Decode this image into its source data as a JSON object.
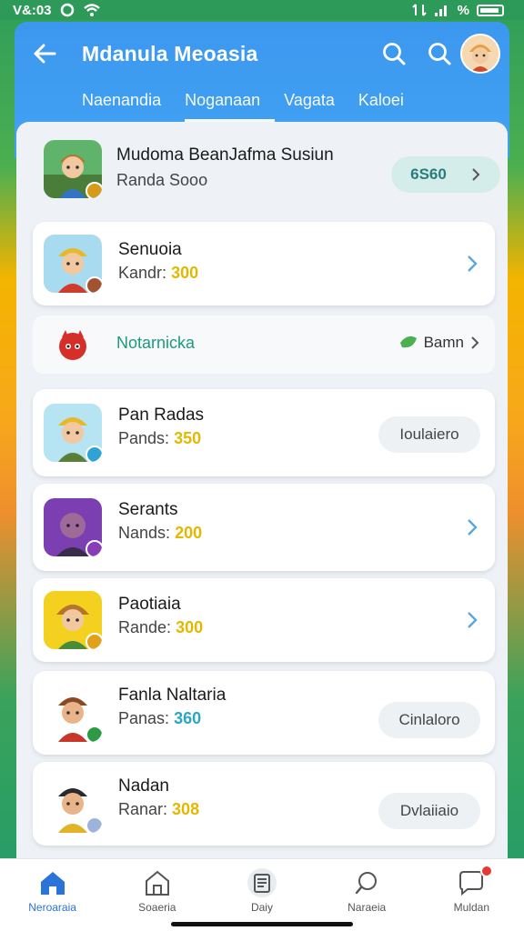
{
  "status_bar": {
    "time": "V&:03",
    "signal_text": "%"
  },
  "header": {
    "title": "Mdanula Meoasia",
    "tabs": [
      {
        "label": "Naenandia",
        "active": false
      },
      {
        "label": "Noganaan",
        "active": true
      },
      {
        "label": "Vagata",
        "active": false
      },
      {
        "label": "Kaloei",
        "active": false
      }
    ]
  },
  "list": {
    "featured": {
      "title": "Mudoma BeanJafma Susiun",
      "subtitle": "Randa Sooo",
      "pill": "6S60",
      "badge_color": "#d79b1a"
    },
    "items": [
      {
        "title": "Senuoia",
        "sub_prefix": "Kandr:",
        "sub_num": "300",
        "action": "chevron",
        "badge_color": "#a1532f"
      },
      {
        "title": "Pan Radas",
        "sub_prefix": "Pands:",
        "sub_num": "350",
        "action": "pill",
        "pill": "Ioulaiero",
        "badge_color": "#2fa3d6"
      },
      {
        "title": "Serants",
        "sub_prefix": "Nands:",
        "sub_num": "200",
        "action": "chevron",
        "badge_color": "#8a3bb8"
      },
      {
        "title": "Paotiaia",
        "sub_prefix": "Rande:",
        "sub_num": "300",
        "action": "chevron",
        "badge_color": "#e2a11a"
      },
      {
        "title": "Fanla Naltaria",
        "sub_prefix": "Panas:",
        "sub_num": "360",
        "action": "pill",
        "pill": "Cinlaloro",
        "badge_color": "#2d9a45"
      },
      {
        "title": "Nadan",
        "sub_prefix": "Ranar:",
        "sub_num": "308",
        "action": "pill",
        "pill": "Dvlaiiaio",
        "badge_color": "#9eb3d9"
      }
    ],
    "notice": {
      "title": "Notarnicka",
      "action_label": "Bamn"
    }
  },
  "bottom_nav": [
    {
      "label": "Neroaraia",
      "icon": "home-icon",
      "active": true
    },
    {
      "label": "Soaeria",
      "icon": "store-icon",
      "active": false
    },
    {
      "label": "Daiy",
      "icon": "list-icon",
      "active": false
    },
    {
      "label": "Naraeia",
      "icon": "search-icon",
      "active": false
    },
    {
      "label": "Muldan",
      "icon": "chat-icon",
      "active": false
    }
  ],
  "colors": {
    "header_blue": "#3c98ef",
    "accent_yellow": "#e3b800",
    "teal_pill": "#d4ecea"
  }
}
